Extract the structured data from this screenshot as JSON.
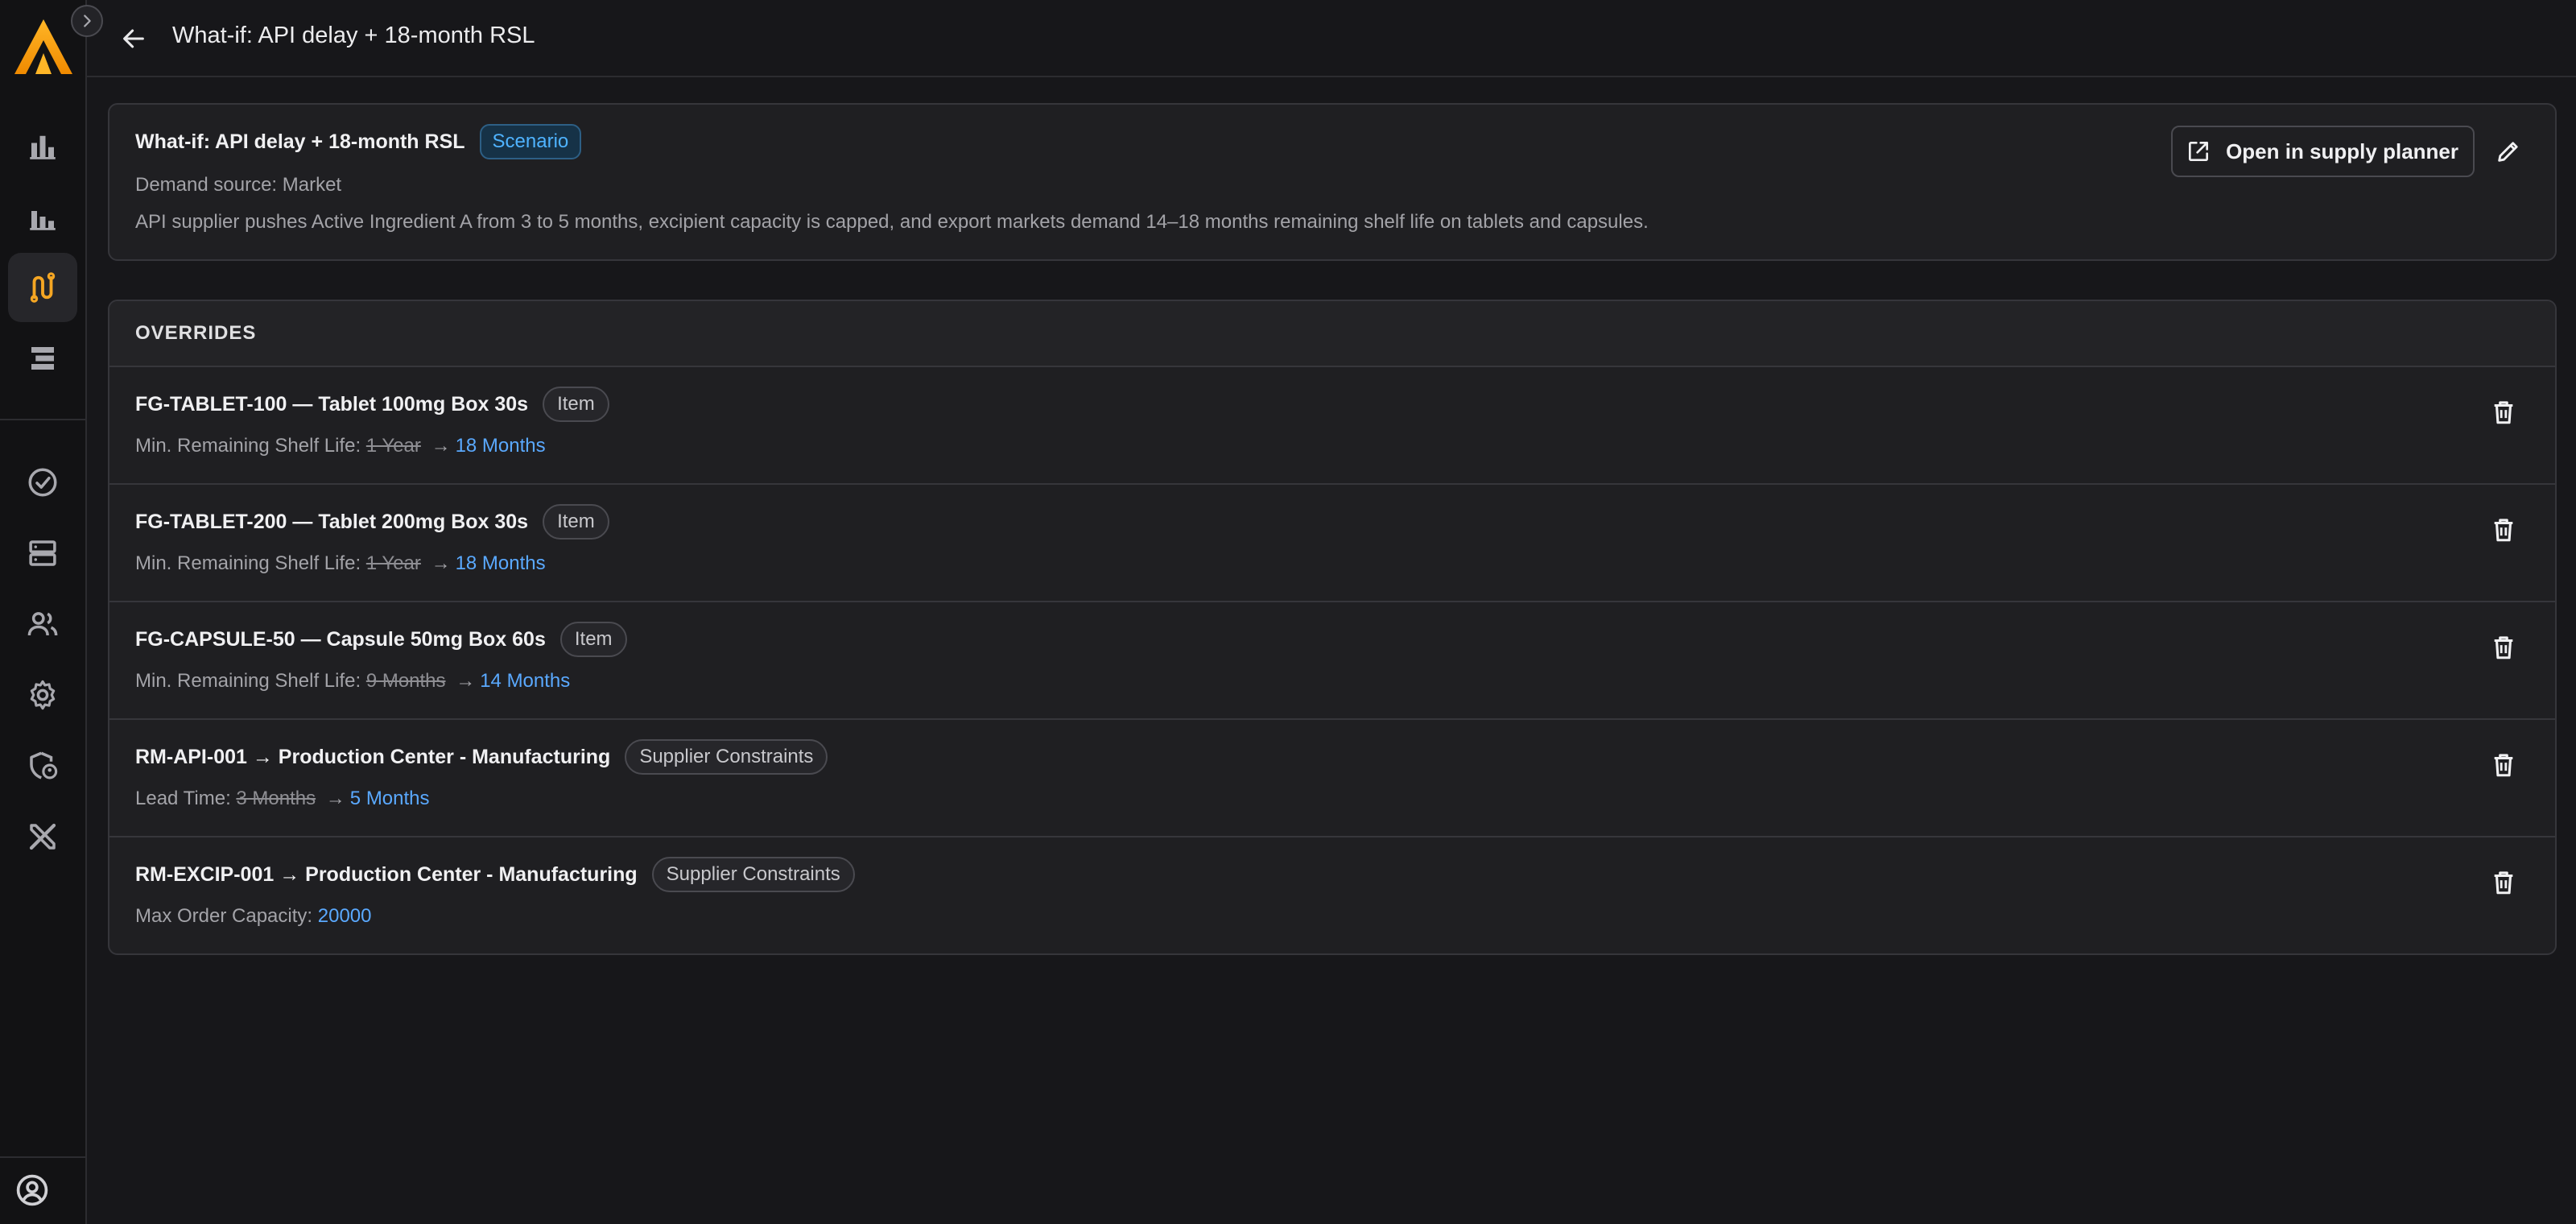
{
  "header": {
    "title": "What-if: API delay + 18-month RSL"
  },
  "scenario": {
    "name": "What-if: API delay + 18-month RSL",
    "badge": "Scenario",
    "demand_source": "Demand source: Market",
    "description": "API supplier pushes Active Ingredient A from 3 to 5 months, excipient capacity is capped, and export markets demand 14–18 months remaining shelf life on tablets and capsules.",
    "open_label": "Open in supply planner"
  },
  "overrides": {
    "heading": "OVERRIDES",
    "rows": [
      {
        "name": "FG-TABLET-100 — Tablet 100mg Box 30s",
        "tag": "Item",
        "field": "Min. Remaining Shelf Life:",
        "old": "1 Year",
        "arrow": "→",
        "new": "18 Months"
      },
      {
        "name": "FG-TABLET-200 — Tablet 200mg Box 30s",
        "tag": "Item",
        "field": "Min. Remaining Shelf Life:",
        "old": "1 Year",
        "arrow": "→",
        "new": "18 Months"
      },
      {
        "name": "FG-CAPSULE-50 — Capsule 50mg Box 60s",
        "tag": "Item",
        "field": "Min. Remaining Shelf Life:",
        "old": "9 Months",
        "arrow": "→",
        "new": "14 Months"
      },
      {
        "name": "RM-API-001 → Production Center - Manufacturing",
        "tag": "Supplier Constraints",
        "field": "Lead Time:",
        "old": "3 Months",
        "arrow": "→",
        "new": "5 Months"
      },
      {
        "name": "RM-EXCIP-001 → Production Center - Manufacturing",
        "tag": "Supplier Constraints",
        "field": "Max Order Capacity:",
        "old": "",
        "arrow": "",
        "new": "20000"
      }
    ]
  },
  "colors": {
    "accent": "#f5a623",
    "link_blue": "#5aa9ff",
    "scenario_badge": "#4fb3ff"
  },
  "icons": {
    "sidebar": [
      "bar-chart-icon",
      "bar-chart-icon",
      "route-icon",
      "stack-icon",
      "check-circle-icon",
      "server-icon",
      "users-icon",
      "gear-icon",
      "shield-user-icon",
      "tools-icon"
    ],
    "header": "arrow-left-icon",
    "row_action": "trash-icon"
  }
}
